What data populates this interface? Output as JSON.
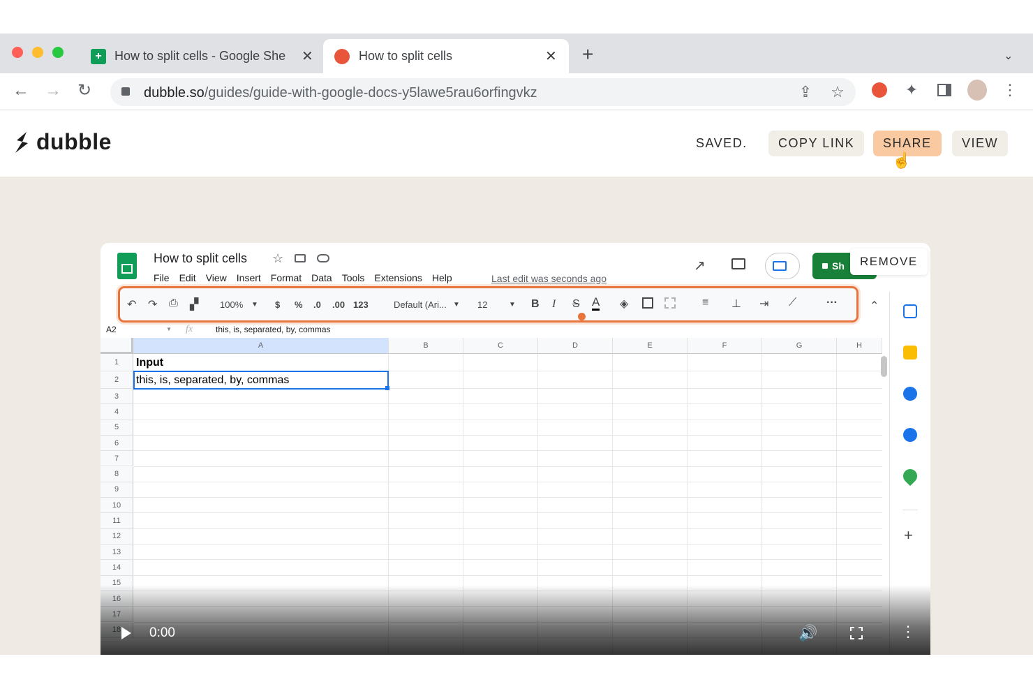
{
  "browser": {
    "tabs": [
      {
        "title": "How to split cells - Google She",
        "close": "✕",
        "favicon": "google-sheets-icon"
      },
      {
        "title": "How to split cells",
        "close": "✕",
        "favicon": "dubble-icon"
      }
    ],
    "new_tab": "+",
    "tab_menu": "⌄",
    "url_domain": "dubble.so",
    "url_path": "/guides/guide-with-google-docs-y5lawe5rau6orfingvkz"
  },
  "app": {
    "logo_text": "dubble",
    "status": "SAVED.",
    "copy_link": "COPY LINK",
    "share": "SHARE",
    "view": "VIEW",
    "accent_color": "#f9c9a2"
  },
  "embed": {
    "remove": "REMOVE",
    "sheet": {
      "title": "How to split cells",
      "menu": [
        "File",
        "Edit",
        "View",
        "Insert",
        "Format",
        "Data",
        "Tools",
        "Extensions",
        "Help"
      ],
      "last_edit": "Last edit was seconds ago",
      "share": "Sh",
      "toolbar": {
        "zoom": "100%",
        "currency": "$",
        "percent": "%",
        "dec_less": ".0",
        "dec_more": ".00",
        "format": "123",
        "font": "Default (Ari...",
        "size": "12",
        "bold": "B",
        "italic": "I",
        "strike": "S",
        "text_color": "A",
        "more": "···"
      },
      "name_box": "A2",
      "fx": "fx",
      "formula": "this, is, separated, by, commas",
      "columns": [
        "A",
        "B",
        "C",
        "D",
        "E",
        "F",
        "G",
        "H"
      ],
      "rows": [
        "1",
        "2",
        "3",
        "4",
        "5",
        "6",
        "7",
        "8",
        "9",
        "10",
        "11",
        "12",
        "13",
        "14",
        "15",
        "16",
        "17",
        "18"
      ],
      "cells": {
        "a1": "Input",
        "a2": "this, is, separated, by, commas"
      },
      "highlight_color": "#e8743b"
    },
    "video": {
      "time": "0:00"
    }
  }
}
